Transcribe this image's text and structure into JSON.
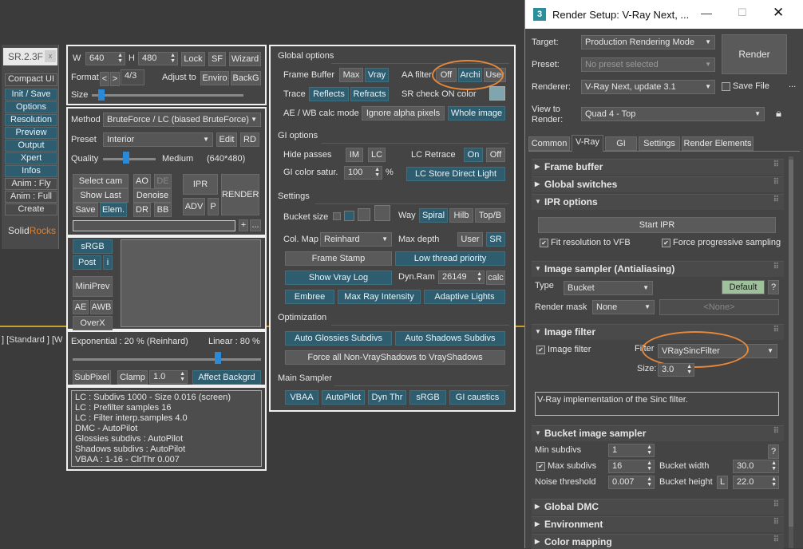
{
  "sr": {
    "version": "SR.2.3F",
    "side": [
      "Compact UI",
      "Init / Save",
      "Options",
      "Resolution",
      "Preview",
      "Output",
      "Xpert",
      "Infos",
      "Anim : Fly",
      "Anim : Full",
      "Create"
    ],
    "logo_solid": "Solid",
    "logo_rocks": "Rocks",
    "viewport_label": "] [Standard ] [W",
    "res": {
      "w_label": "W",
      "w": "640",
      "h_label": "H",
      "h": "480",
      "lock": "Lock",
      "sf": "SF",
      "wizard": "Wizard",
      "format_label": "Format",
      "prev": "<",
      "next": ">",
      "ratio": "4/3",
      "adjust_label": "Adjust to",
      "enviro": "Enviro",
      "backg": "BackG",
      "size_label": "Size"
    },
    "method": {
      "method_label": "Method",
      "method_value": "BruteForce / LC (biased BruteForce)",
      "preset_label": "Preset",
      "preset_value": "Interior",
      "edit": "Edit",
      "rd": "RD",
      "quality_label": "Quality",
      "quality_value": "Medium",
      "quality_res": "(640*480)",
      "select_cam": "Select cam",
      "ao": "AO",
      "de": "DE",
      "ipr": "IPR",
      "render": "RENDER",
      "show_last": "Show Last",
      "denoise": "Denoise",
      "adv": "ADV",
      "p": "P",
      "save": "Save",
      "elem": "Elem.",
      "dr": "DR",
      "bb": "BB",
      "plus": "+",
      "more": "..."
    },
    "color": {
      "srgb": "sRGB",
      "post": "Post",
      "i": "i",
      "miniprev": "MiniPrev",
      "ae": "AE",
      "awb": "AWB",
      "overx": "OverX"
    },
    "exposure": {
      "exp_label": "Exponential : 20 %  (Reinhard)",
      "lin_label": "Linear : 80 %",
      "subpixel": "SubPixel",
      "clamp": "Clamp",
      "clamp_value": "1.0",
      "affect": "Affect Backgrd"
    },
    "info": [
      "LC : Subdivs 1000 - Size 0.016 (screen)",
      "LC : Prefilter samples 16",
      "LC : Filter interp.samples  4.0",
      "DMC - AutoPilot",
      "Glossies subdivs : AutoPilot",
      "Shadows subdivs : AutoPilot",
      "VBAA : 1-16 - ClrThr 0.007"
    ]
  },
  "go": {
    "global_title": "Global options",
    "frame_buffer": "Frame Buffer",
    "max": "Max",
    "vray": "Vray",
    "aa_filter": "AA filter",
    "off": "Off",
    "archi": "Archi",
    "user": "User",
    "trace": "Trace",
    "reflects": "Reflects",
    "refracts": "Refracts",
    "sr_check": "SR check ON color",
    "aewb": "AE / WB calc mode",
    "ignore_alpha": "Ignore alpha pixels",
    "whole_image": "Whole image",
    "gi_title": "GI options",
    "hide_passes": "Hide passes",
    "im": "IM",
    "lc": "LC",
    "lc_retrace": "LC Retrace",
    "on": "On",
    "off2": "Off",
    "gi_color": "GI color satur.",
    "gi_color_value": "100",
    "pct": "%",
    "lc_store": "LC Store Direct Light",
    "settings_title": "Settings",
    "bucket_size": "Bucket size",
    "way": "Way",
    "spiral": "Spiral",
    "hilb": "Hilb",
    "topb": "Top/B",
    "colmap": "Col. Map",
    "colmap_value": "Reinhard",
    "max_depth": "Max depth",
    "user2": "User",
    "sr": "SR",
    "frame_stamp": "Frame Stamp",
    "low_thread": "Low thread priority",
    "show_vray_log": "Show Vray Log",
    "dynram": "Dyn.Ram",
    "dynram_value": "26149",
    "calc": "calc",
    "embree": "Embree",
    "max_ray": "Max Ray Intensity",
    "adaptive": "Adaptive Lights",
    "opt_title": "Optimization",
    "auto_glossies": "Auto Glossies Subdivs",
    "auto_shadows": "Auto Shadows Subdivs",
    "force_shadows": "Force all Non-VrayShadows to VrayShadows",
    "main_title": "Main Sampler",
    "vbaa": "VBAA",
    "autopilot": "AutoPilot",
    "dynthr": "Dyn Thr",
    "srgb": "sRGB",
    "gicaustics": "GI caustics"
  },
  "rs": {
    "title": "Render Setup: V-Ray Next, ...",
    "target_label": "Target:",
    "target_value": "Production Rendering Mode",
    "preset_label": "Preset:",
    "preset_value": "No preset selected",
    "renderer_label": "Renderer:",
    "renderer_value": "V-Ray Next, update 3.1",
    "save_file": "Save File",
    "render_btn": "Render",
    "view_label1": "View to",
    "view_label2": "Render:",
    "view_value": "Quad 4 - Top",
    "tabs": [
      "Common",
      "V-Ray",
      "GI",
      "Settings",
      "Render Elements"
    ],
    "rollouts": {
      "frame_buffer": "Frame buffer",
      "global_switches": "Global switches",
      "ipr": "IPR options",
      "start_ipr": "Start IPR",
      "fit_vfb": "Fit resolution to VFB",
      "force_prog": "Force progressive sampling",
      "image_sampler": "Image sampler (Antialiasing)",
      "type_label": "Type",
      "type_value": "Bucket",
      "default": "Default",
      "q": "?",
      "mask_label": "Render mask",
      "mask_value": "None",
      "mask_none": "<None>",
      "image_filter": "Image filter",
      "if_check": "Image filter",
      "filter_label": "Filter",
      "filter_value": "VRaySincFilter",
      "size_label": "Size:",
      "size_value": "3.0",
      "filter_desc": "V-Ray implementation of the Sinc filter.",
      "bucket_sampler": "Bucket image sampler",
      "min_subdivs": "Min subdivs",
      "min_value": "1",
      "max_subdivs": "Max subdivs",
      "max_value": "16",
      "bucket_width": "Bucket width",
      "bw_value": "30.0",
      "noise": "Noise threshold",
      "noise_value": "0.007",
      "bucket_height": "Bucket height",
      "l": "L",
      "bh_value": "22.0",
      "global_dmc": "Global DMC",
      "environment": "Environment",
      "color_mapping": "Color mapping"
    }
  },
  "colors": {
    "accent_blue": "#2f5d70",
    "annotation": "#e8883a",
    "sr_check_swatch": "#7fa6ae",
    "default_btn": "#9ec09a"
  }
}
